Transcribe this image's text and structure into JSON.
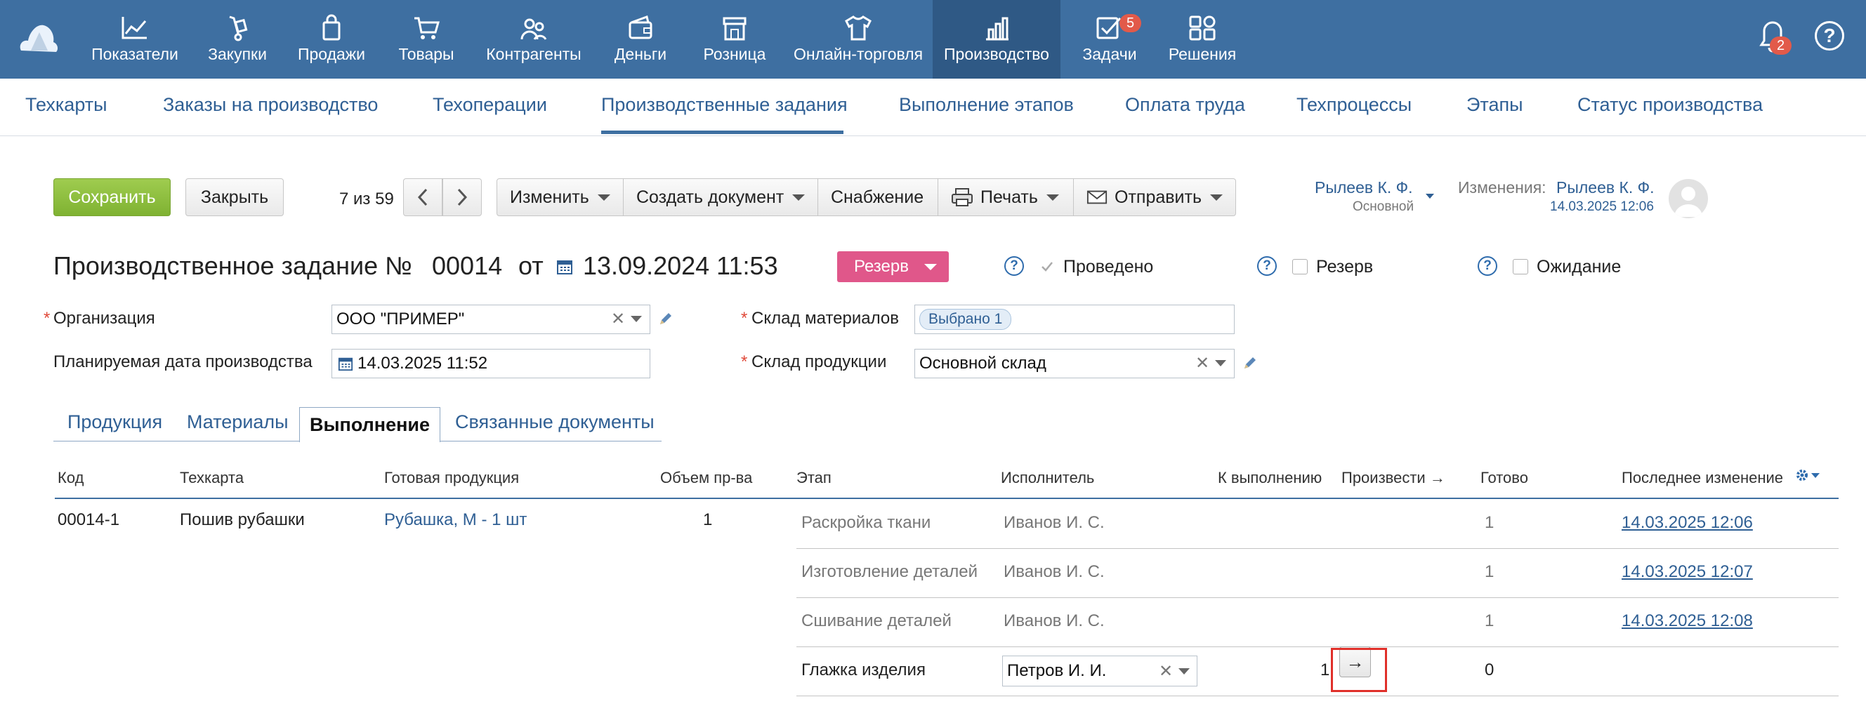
{
  "nav": {
    "items": [
      {
        "label": "Показатели",
        "icon": "chart-line-icon"
      },
      {
        "label": "Закупки",
        "icon": "hand-truck-icon"
      },
      {
        "label": "Продажи",
        "icon": "shopping-bag-icon"
      },
      {
        "label": "Товары",
        "icon": "cart-icon"
      },
      {
        "label": "Контрагенты",
        "icon": "people-icon"
      },
      {
        "label": "Деньги",
        "icon": "wallet-icon"
      },
      {
        "label": "Розница",
        "icon": "store-icon"
      },
      {
        "label": "Онлайн-торговля",
        "icon": "shirt-icon"
      },
      {
        "label": "Производство",
        "icon": "bars-chart-icon"
      },
      {
        "label": "Задачи",
        "icon": "tasks-icon"
      },
      {
        "label": "Решения",
        "icon": "apps-grid-icon"
      }
    ],
    "active": "Производство",
    "tasks_badge": "5",
    "notifications_badge": "2",
    "help": "?"
  },
  "subnav": {
    "items": [
      "Техкарты",
      "Заказы на производство",
      "Техоперации",
      "Производственные задания",
      "Выполнение этапов",
      "Оплата труда",
      "Техпроцессы",
      "Этапы",
      "Статус производства"
    ],
    "active": "Производственные задания"
  },
  "toolbar": {
    "save": "Сохранить",
    "close": "Закрыть",
    "pager": "7 из 59",
    "change": "Изменить",
    "create_doc": "Создать документ",
    "supply": "Снабжение",
    "print": "Печать",
    "send": "Отправить"
  },
  "owner": {
    "name": "Рылеев К. Ф.",
    "role": "Основной"
  },
  "changes": {
    "label": "Изменения:",
    "name": "Рылеев К. Ф.",
    "date": "14.03.2025 12:06"
  },
  "doc": {
    "title": "Производственное задание №",
    "number": "00014",
    "from": "от",
    "date": "13.09.2024 11:53",
    "reserve_button": "Резерв",
    "posted": "Проведено",
    "reserve": "Резерв",
    "waiting": "Ожидание"
  },
  "form": {
    "org_label": "Организация",
    "org_value": "ООО \"ПРИМЕР\"",
    "plan_date_label": "Планируемая дата производства",
    "plan_date_value": "14.03.2025 11:52",
    "mat_stock_label": "Склад материалов",
    "mat_stock_value": "Выбрано 1",
    "prod_stock_label": "Склад продукции",
    "prod_stock_value": "Основной склад"
  },
  "tabs": [
    "Продукция",
    "Материалы",
    "Выполнение",
    "Связанные документы"
  ],
  "table": {
    "headers": [
      "Код",
      "Техкарта",
      "Готовая продукция",
      "Объем пр-ва",
      "Этап",
      "Исполнитель",
      "К выполнению",
      "Произвести →",
      "Готово",
      "Последнее изменение"
    ],
    "order": {
      "code": "00014-1",
      "techcard": "Пошив рубашки",
      "product": "Рубашка, M - 1 шт",
      "volume": "1"
    },
    "stages": [
      {
        "stage": "Раскройка ткани",
        "executor": "Иванов И. С.",
        "todo": "",
        "done": "1",
        "changed": "14.03.2025 12:06"
      },
      {
        "stage": "Изготовление деталей",
        "executor": "Иванов И. С.",
        "todo": "",
        "done": "1",
        "changed": "14.03.2025 12:07"
      },
      {
        "stage": "Сшивание деталей",
        "executor": "Иванов И. С.",
        "todo": "",
        "done": "1",
        "changed": "14.03.2025 12:08"
      },
      {
        "stage": "Глажка изделия",
        "executor": "Петров И. И.",
        "todo": "1",
        "done": "0",
        "changed": ""
      }
    ],
    "produce_button": "→"
  }
}
